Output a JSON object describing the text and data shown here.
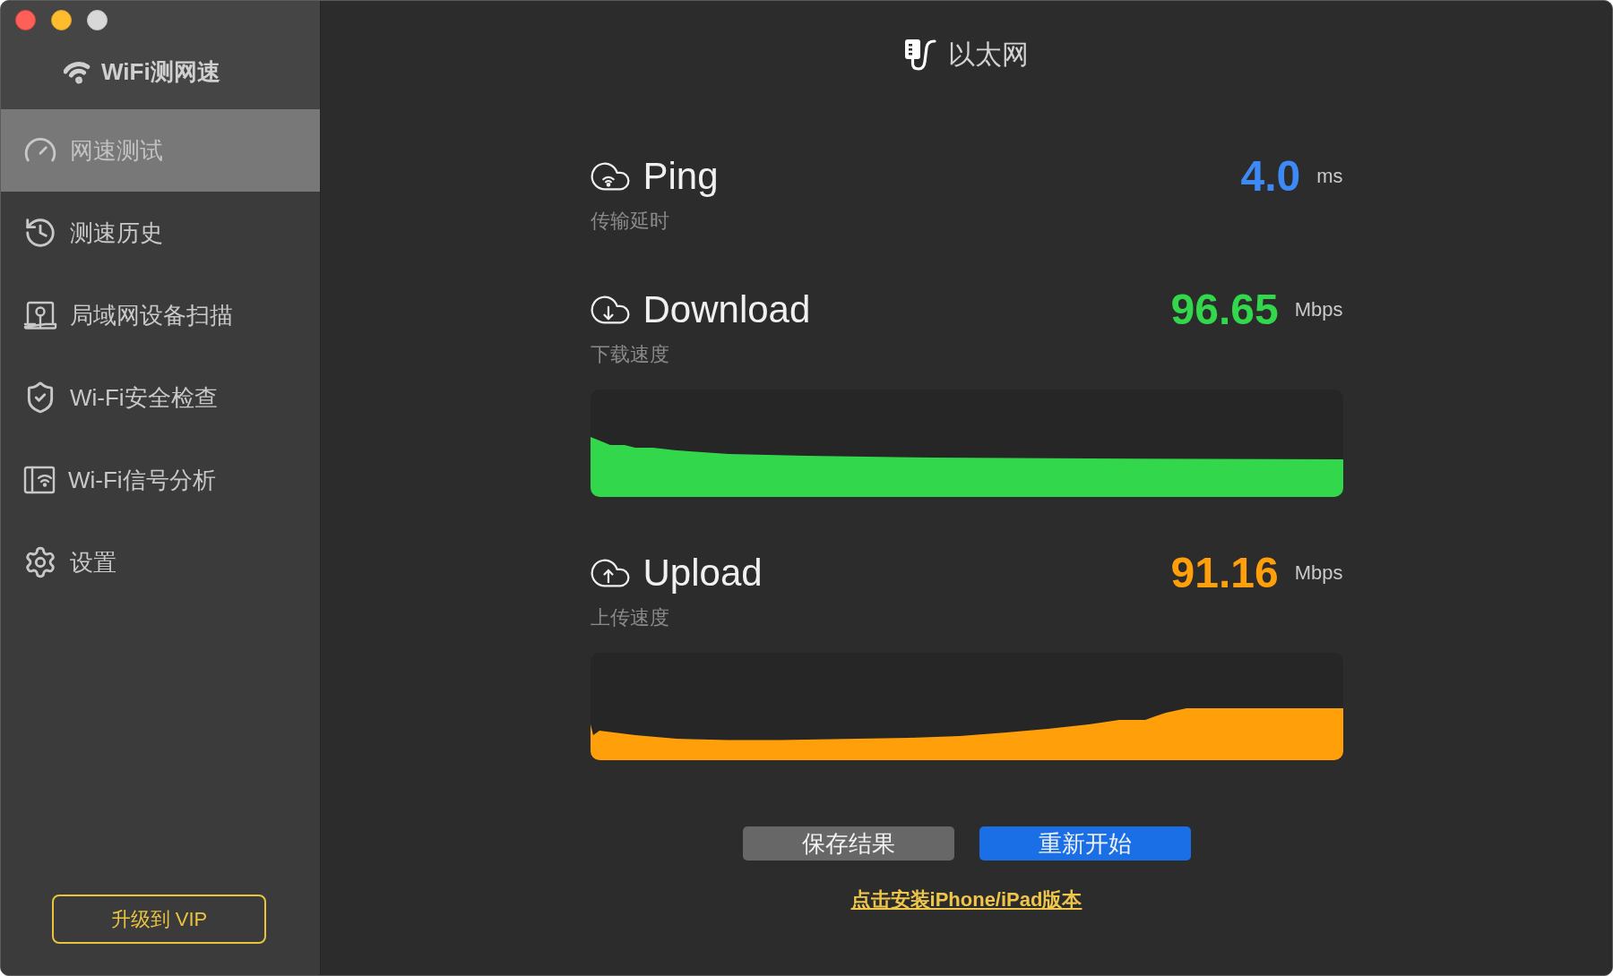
{
  "window": {
    "controls": [
      {
        "kind": "close",
        "disabled": false
      },
      {
        "kind": "minimize",
        "disabled": false
      },
      {
        "kind": "zoom",
        "disabled": true
      }
    ]
  },
  "sidebar": {
    "app_title": "WiFi测网速",
    "items": [
      {
        "label": "网速测试",
        "selected": true
      },
      {
        "label": "测速历史",
        "selected": false
      },
      {
        "label": "局域网设备扫描",
        "selected": false
      },
      {
        "label": "Wi-Fi安全检查",
        "selected": false
      },
      {
        "label": "Wi-Fi信号分析",
        "selected": false
      },
      {
        "label": "设置",
        "selected": false
      }
    ],
    "upgrade_button": "升级到 VIP"
  },
  "header": {
    "connection": "以太网"
  },
  "metrics": [
    {
      "kind": "ping",
      "title": "Ping",
      "subtitle": "传输延时",
      "value": "4.0",
      "unit": "ms",
      "color": "#3d8af7"
    },
    {
      "kind": "download",
      "title": "Download",
      "subtitle": "下载速度",
      "value": "96.65",
      "unit": "Mbps",
      "color": "#32d74b"
    },
    {
      "kind": "upload",
      "title": "Upload",
      "subtitle": "上传速度",
      "value": "91.16",
      "unit": "Mbps",
      "color": "#ff9f0a"
    }
  ],
  "buttons": [
    {
      "label": "保存结果",
      "kind": "secondary"
    },
    {
      "label": "重新开始",
      "kind": "primary"
    }
  ],
  "install_link": "点击安装iPhone/iPad版本"
}
